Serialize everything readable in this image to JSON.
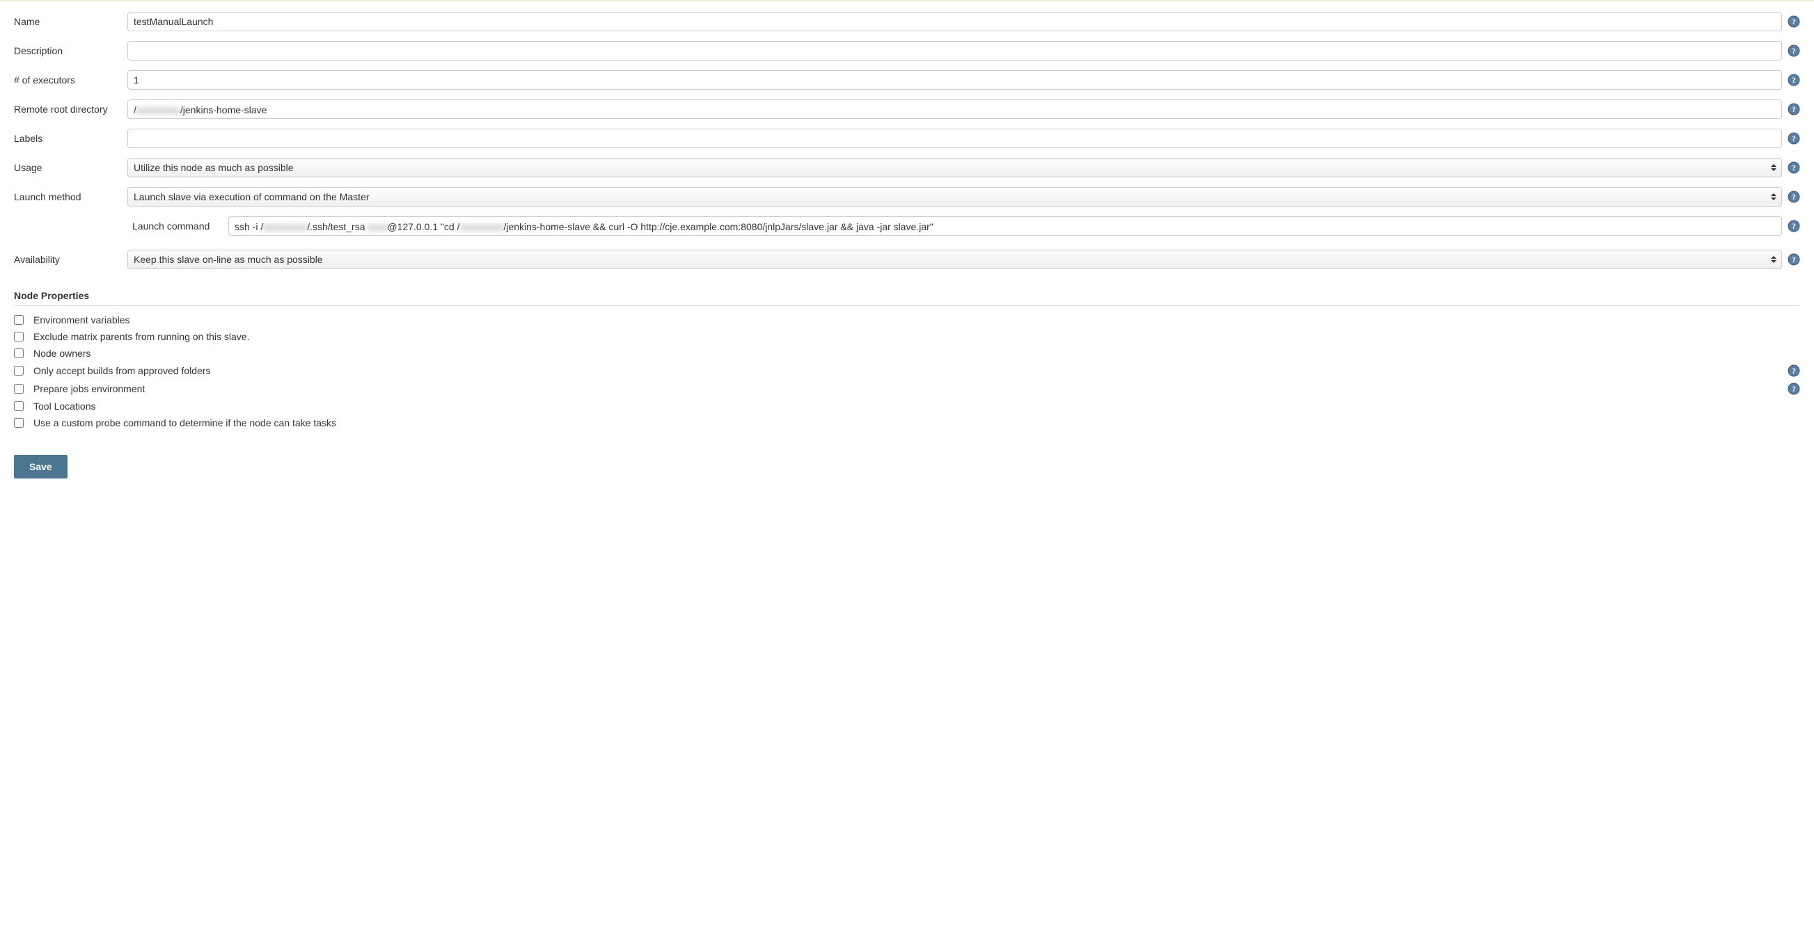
{
  "fields": {
    "name": {
      "label": "Name",
      "value": "testManualLaunch"
    },
    "description": {
      "label": "Description",
      "value": ""
    },
    "num_executors": {
      "label": "# of executors",
      "value": "1"
    },
    "remote_root": {
      "label": "Remote root directory",
      "prefix": "/",
      "blurred": "xxxxxxxxx",
      "suffix": "/jenkins-home-slave"
    },
    "labels": {
      "label": "Labels",
      "value": ""
    },
    "usage": {
      "label": "Usage",
      "value": "Utilize this node as much as possible"
    },
    "launch_method": {
      "label": "Launch method",
      "value": "Launch slave via execution of command on the Master"
    },
    "launch_command": {
      "label": "Launch command",
      "p1": "ssh -i /",
      "b1": "xxxxxxxxx",
      "p2": "/.ssh/test_rsa ",
      "b2": "xxxx",
      "p3": "@127.0.0.1 \"cd /",
      "b3": "xxxxxxxxx",
      "p4": "/jenkins-home-slave && curl -O http://cje.example.com:8080/jnlpJars/slave.jar && java -jar slave.jar\""
    },
    "availability": {
      "label": "Availability",
      "value": "Keep this slave on-line as much as possible"
    }
  },
  "node_properties": {
    "heading": "Node Properties",
    "items": [
      {
        "label": "Environment variables",
        "help": false
      },
      {
        "label": "Exclude matrix parents from running on this slave.",
        "help": false
      },
      {
        "label": "Node owners",
        "help": false
      },
      {
        "label": "Only accept builds from approved folders",
        "help": true
      },
      {
        "label": "Prepare jobs environment",
        "help": true
      },
      {
        "label": "Tool Locations",
        "help": false
      },
      {
        "label": "Use a custom probe command to determine if the node can take tasks",
        "help": false
      }
    ]
  },
  "buttons": {
    "save": "Save"
  }
}
